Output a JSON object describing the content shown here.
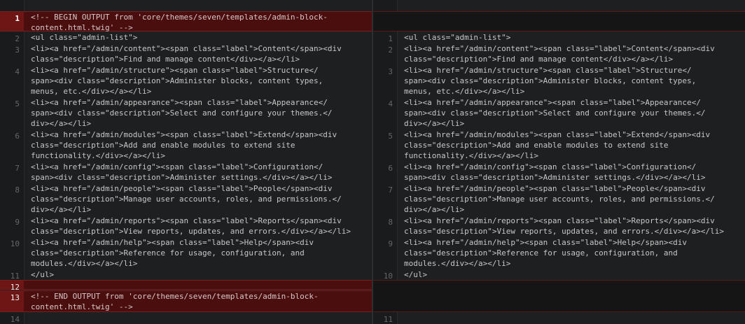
{
  "left": {
    "lines": [
      {
        "num": "1",
        "code": "<!-- BEGIN OUTPUT from 'core/themes/seven/templates/admin-block-\ncontent.html.twig' -->",
        "type": "del"
      },
      {
        "num": "2",
        "code": "<ul class=\"admin-list\">",
        "type": "normal"
      },
      {
        "num": "3",
        "code": "<li><a href=\"/admin/content\"><span class=\"label\">Content</span><div\nclass=\"description\">Find and manage content</div></a></li>",
        "type": "normal"
      },
      {
        "num": "4",
        "code": "<li><a href=\"/admin/structure\"><span class=\"label\">Structure</\nspan><div class=\"description\">Administer blocks, content types,\nmenus, etc.</div></a></li>",
        "type": "normal"
      },
      {
        "num": "5",
        "code": "<li><a href=\"/admin/appearance\"><span class=\"label\">Appearance</\nspan><div class=\"description\">Select and configure your themes.</\ndiv></a></li>",
        "type": "normal"
      },
      {
        "num": "6",
        "code": "<li><a href=\"/admin/modules\"><span class=\"label\">Extend</span><div\nclass=\"description\">Add and enable modules to extend site\nfunctionality.</div></a></li>",
        "type": "normal"
      },
      {
        "num": "7",
        "code": "<li><a href=\"/admin/config\"><span class=\"label\">Configuration</\nspan><div class=\"description\">Administer settings.</div></a></li>",
        "type": "normal"
      },
      {
        "num": "8",
        "code": "<li><a href=\"/admin/people\"><span class=\"label\">People</span><div\nclass=\"description\">Manage user accounts, roles, and permissions.</\ndiv></a></li>",
        "type": "normal"
      },
      {
        "num": "9",
        "code": "<li><a href=\"/admin/reports\"><span class=\"label\">Reports</span><div\nclass=\"description\">View reports, updates, and errors.</div></a></li>",
        "type": "normal"
      },
      {
        "num": "10",
        "code": "<li><a href=\"/admin/help\"><span class=\"label\">Help</span><div\nclass=\"description\">Reference for usage, configuration, and\nmodules.</div></a></li>",
        "type": "normal"
      },
      {
        "num": "11",
        "code": "</ul>",
        "type": "normal"
      },
      {
        "num": "12",
        "code": "",
        "type": "del"
      },
      {
        "num": "13",
        "code": "<!-- END OUTPUT from 'core/themes/seven/templates/admin-block-\ncontent.html.twig' -->",
        "type": "del"
      },
      {
        "num": "14",
        "code": "",
        "type": "normal"
      }
    ]
  },
  "right": {
    "lines": [
      {
        "num": "",
        "code": "",
        "type": "gap"
      },
      {
        "num": "1",
        "code": "<ul class=\"admin-list\">",
        "type": "normal"
      },
      {
        "num": "2",
        "code": "<li><a href=\"/admin/content\"><span class=\"label\">Content</span><div\nclass=\"description\">Find and manage content</div></a></li>",
        "type": "normal"
      },
      {
        "num": "3",
        "code": "<li><a href=\"/admin/structure\"><span class=\"label\">Structure</\nspan><div class=\"description\">Administer blocks, content types,\nmenus, etc.</div></a></li>",
        "type": "normal"
      },
      {
        "num": "4",
        "code": "<li><a href=\"/admin/appearance\"><span class=\"label\">Appearance</\nspan><div class=\"description\">Select and configure your themes.</\ndiv></a></li>",
        "type": "normal"
      },
      {
        "num": "5",
        "code": "<li><a href=\"/admin/modules\"><span class=\"label\">Extend</span><div\nclass=\"description\">Add and enable modules to extend site\nfunctionality.</div></a></li>",
        "type": "normal"
      },
      {
        "num": "6",
        "code": "<li><a href=\"/admin/config\"><span class=\"label\">Configuration</\nspan><div class=\"description\">Administer settings.</div></a></li>",
        "type": "normal"
      },
      {
        "num": "7",
        "code": "<li><a href=\"/admin/people\"><span class=\"label\">People</span><div\nclass=\"description\">Manage user accounts, roles, and permissions.</\ndiv></a></li>",
        "type": "normal"
      },
      {
        "num": "8",
        "code": "<li><a href=\"/admin/reports\"><span class=\"label\">Reports</span><div\nclass=\"description\">View reports, updates, and errors.</div></a></li>",
        "type": "normal"
      },
      {
        "num": "9",
        "code": "<li><a href=\"/admin/help\"><span class=\"label\">Help</span><div\nclass=\"description\">Reference for usage, configuration, and\nmodules.</div></a></li>",
        "type": "normal"
      },
      {
        "num": "10",
        "code": "</ul>",
        "type": "normal"
      },
      {
        "num": "",
        "code": "",
        "type": "gap"
      },
      {
        "num": "11",
        "code": "",
        "type": "normal"
      }
    ]
  },
  "colors": {
    "background": "#1d1f21",
    "deleted_line_bg": "#4a0e0e",
    "deleted_gutter_bg": "#6e1616",
    "gap_bg": "#151515",
    "text": "#c5c8c6",
    "line_number": "#666666"
  }
}
